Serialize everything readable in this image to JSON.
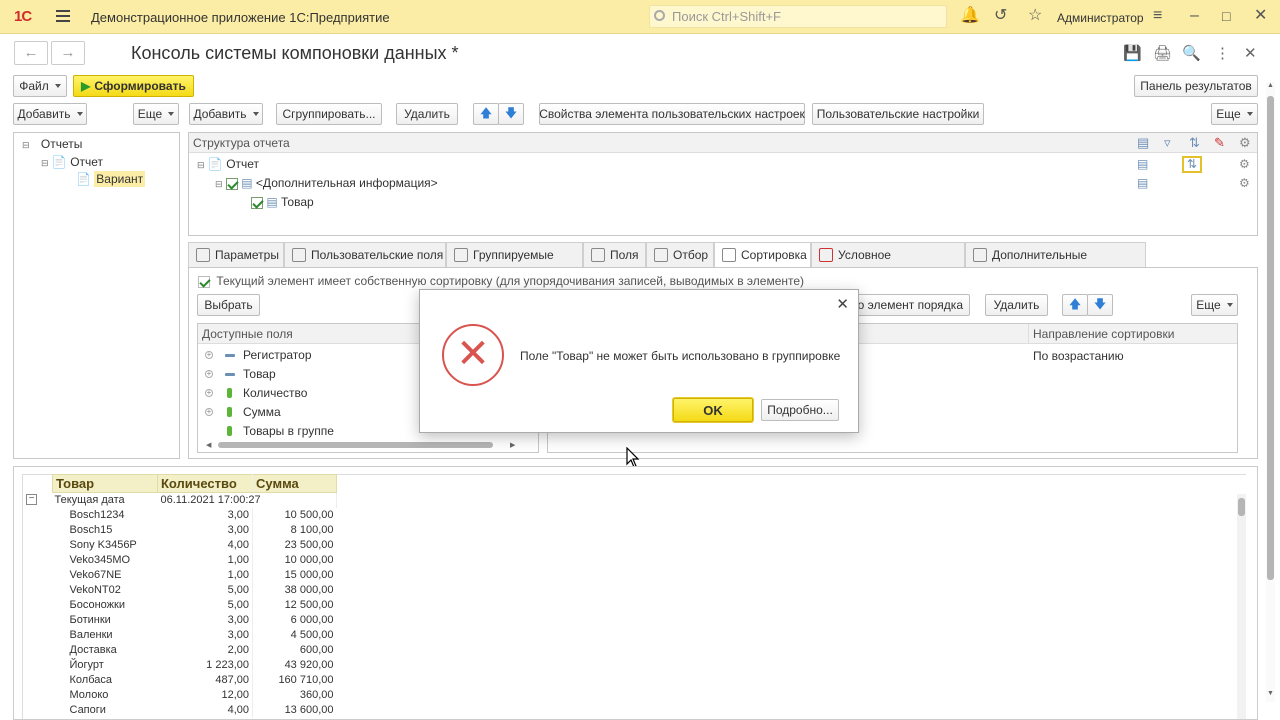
{
  "app": {
    "logo": "1С",
    "title": "Демонстрационное приложение 1С:Предприятие",
    "search_placeholder": "Поиск Ctrl+Shift+F",
    "user": "Администратор"
  },
  "window": {
    "title": "Консоль системы компоновки данных *"
  },
  "toolbar_main": {
    "file": "Файл",
    "generate": "Сформировать",
    "results_panel": "Панель результатов"
  },
  "toolbar_left": {
    "add": "Добавить",
    "more": "Еще"
  },
  "toolbar_struct": {
    "add": "Добавить",
    "group": "Сгруппировать...",
    "delete": "Удалить",
    "element_props": "Свойства элемента пользовательских настроек",
    "user_settings": "Пользовательские настройки",
    "more": "Еще"
  },
  "tree_left": [
    {
      "label": "Отчеты",
      "level": 0
    },
    {
      "label": "Отчет",
      "level": 1
    },
    {
      "label": "Вариант",
      "level": 2
    }
  ],
  "structure": {
    "header": "Структура отчета",
    "rows": [
      {
        "label": "Отчет"
      },
      {
        "label": "<Дополнительная информация>"
      },
      {
        "label": "Товар"
      }
    ]
  },
  "tabs": [
    {
      "label": "Параметры"
    },
    {
      "label": "Пользовательские поля"
    },
    {
      "label": "Группируемые поля"
    },
    {
      "label": "Поля"
    },
    {
      "label": "Отбор"
    },
    {
      "label": "Сортировка"
    },
    {
      "label": "Условное оформление"
    },
    {
      "label": "Дополнительные настройки"
    }
  ],
  "sort": {
    "own_sort_label": "Текущий элемент имеет собственную сортировку (для упорядочивания записей, выводимых в элементе)",
    "choose": "Выбрать",
    "auto_order": "то элемент порядка",
    "delete": "Удалить",
    "more": "Еще",
    "available_header": "Доступные поля",
    "available": [
      "Регистратор",
      "Товар",
      "Количество",
      "Сумма",
      "Товары в группе"
    ],
    "direction_header": "Направление сортировки",
    "direction_value": "По возрастанию"
  },
  "dialog": {
    "message": "Поле \"Товар\" не может быть использовано в группировке",
    "ok": "OK",
    "details": "Подробно..."
  },
  "report": {
    "headers": [
      "Товар",
      "Количество",
      "Сумма"
    ],
    "group_label": "Текущая дата",
    "group_value": "06.11.2021 17:00:27",
    "rows": [
      [
        "Bosch1234",
        "3,00",
        "10 500,00"
      ],
      [
        "Bosch15",
        "3,00",
        "8 100,00"
      ],
      [
        "Sony K3456P",
        "4,00",
        "23 500,00"
      ],
      [
        "Veko345MO",
        "1,00",
        "10 000,00"
      ],
      [
        "Veko67NE",
        "1,00",
        "15 000,00"
      ],
      [
        "VekoNT02",
        "5,00",
        "38 000,00"
      ],
      [
        "Босоножки",
        "5,00",
        "12 500,00"
      ],
      [
        "Ботинки",
        "3,00",
        "6 000,00"
      ],
      [
        "Валенки",
        "3,00",
        "4 500,00"
      ],
      [
        "Доставка",
        "2,00",
        "600,00"
      ],
      [
        "Йогурт",
        "1 223,00",
        "43 920,00"
      ],
      [
        "Колбаса",
        "487,00",
        "160 710,00"
      ],
      [
        "Молоко",
        "12,00",
        "360,00"
      ],
      [
        "Сапоги",
        "4,00",
        "13 600,00"
      ]
    ]
  }
}
